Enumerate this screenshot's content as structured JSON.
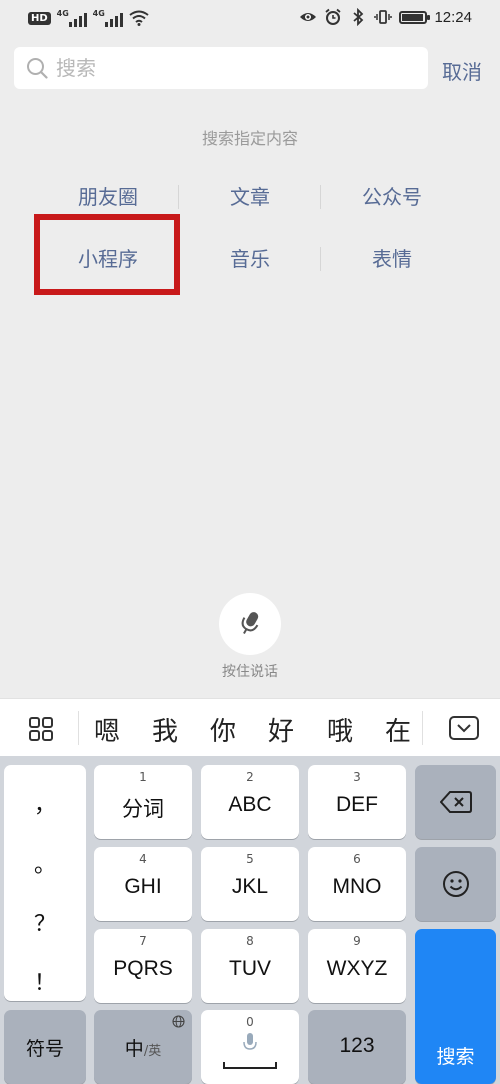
{
  "status_bar": {
    "network_badge": "HD",
    "sim1_tag": "4G",
    "sim2_tag": "4G",
    "battery_level": 0.85,
    "time": "12:24"
  },
  "search": {
    "placeholder": "搜索",
    "cancel_label": "取消"
  },
  "hint": "搜索指定内容",
  "categories": [
    [
      "朋友圈",
      "文章",
      "公众号"
    ],
    [
      "小程序",
      "音乐",
      "表情"
    ]
  ],
  "voice": {
    "label": "按住说话",
    "icon": "microphone-icon"
  },
  "candidates": [
    "嗯",
    "我",
    "你",
    "好",
    "哦",
    "在"
  ],
  "keyboard": {
    "punctuation": [
      "，",
      "。",
      "？",
      "！"
    ],
    "keys": [
      {
        "num": "1",
        "label": "分词"
      },
      {
        "num": "2",
        "label": "ABC"
      },
      {
        "num": "3",
        "label": "DEF"
      },
      {
        "num": "4",
        "label": "GHI"
      },
      {
        "num": "5",
        "label": "JKL"
      },
      {
        "num": "6",
        "label": "MNO"
      },
      {
        "num": "7",
        "label": "PQRS"
      },
      {
        "num": "8",
        "label": "TUV"
      },
      {
        "num": "9",
        "label": "WXYZ"
      }
    ],
    "symbol_label": "符号",
    "lang_main": "中",
    "lang_alt": "/英",
    "space_num": "0",
    "num_label": "123",
    "search_label": "搜索"
  },
  "colors": {
    "link_blue": "#576b95",
    "highlight_red": "#c8191a",
    "key_blue": "#1f86f5",
    "background": "#ededed"
  }
}
